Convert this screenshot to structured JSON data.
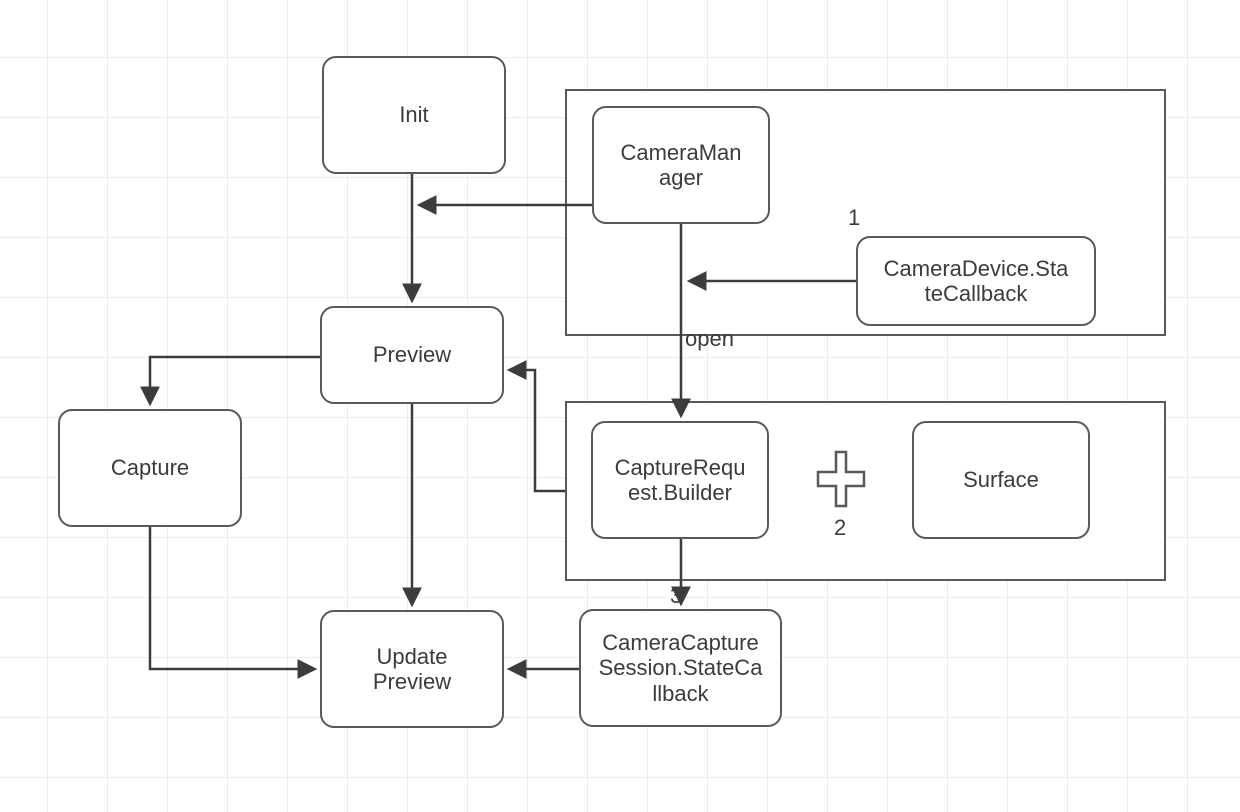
{
  "diagram": {
    "nodes": {
      "init": "Init",
      "preview": "Preview",
      "capture": "Capture",
      "update_preview": "Update Preview",
      "camera_manager": "CameraMan ager",
      "camera_device_state_callback": "CameraDevice.Sta teCallback",
      "capture_request_builder": "CaptureRequ est.Builder",
      "surface": "Surface",
      "camera_capture_session_state_callback": "CameraCapture Session.StateCa llback"
    },
    "annotations": {
      "open": "open",
      "num1": "1",
      "num2": "2",
      "num3": "3"
    }
  }
}
